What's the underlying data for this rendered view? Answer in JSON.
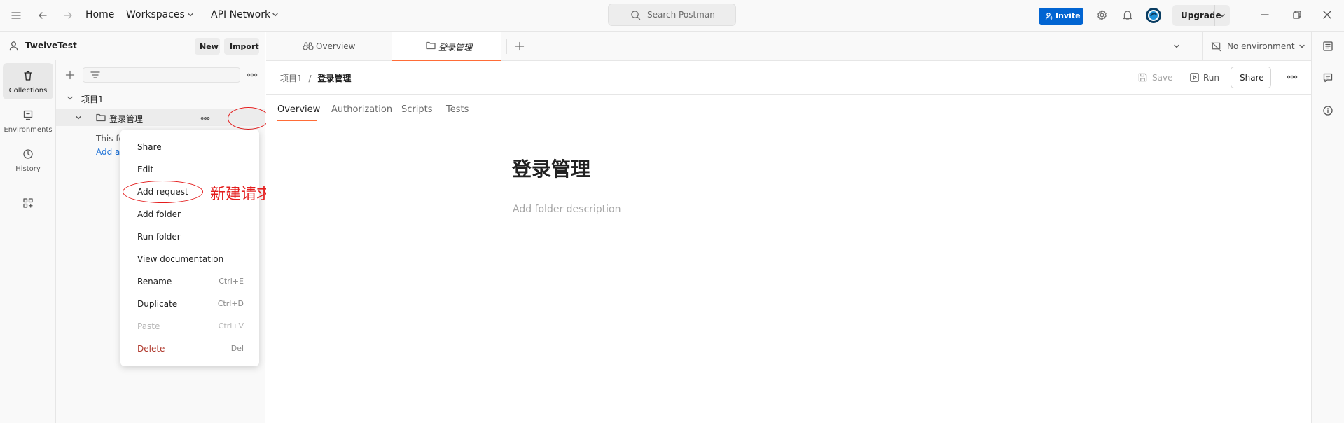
{
  "topbar": {
    "home": "Home",
    "workspaces": "Workspaces",
    "api_network": "API Network",
    "search_placeholder": "Search Postman",
    "invite": "Invite",
    "upgrade": "Upgrade"
  },
  "workspace": {
    "name": "TwelveTest",
    "new_label": "New",
    "import_label": "Import"
  },
  "rail": {
    "collections": "Collections",
    "environments": "Environments",
    "history": "History"
  },
  "tree": {
    "collection_name": "项目1",
    "folder_name": "登录管理",
    "hint_line1": "This fo",
    "hint_link": "Add a"
  },
  "context_menu": {
    "items": [
      {
        "label": "Share",
        "shortcut": ""
      },
      {
        "label": "Edit",
        "shortcut": ""
      },
      {
        "label": "Add request",
        "shortcut": ""
      },
      {
        "label": "Add folder",
        "shortcut": ""
      },
      {
        "label": "Run folder",
        "shortcut": ""
      },
      {
        "label": "View documentation",
        "shortcut": ""
      },
      {
        "label": "Rename",
        "shortcut": "Ctrl+E"
      },
      {
        "label": "Duplicate",
        "shortcut": "Ctrl+D"
      },
      {
        "label": "Paste",
        "shortcut": "Ctrl+V"
      },
      {
        "label": "Delete",
        "shortcut": "Del"
      }
    ]
  },
  "annotation": {
    "text": "新建请求",
    "color": "#e41c1c"
  },
  "tabs": {
    "overview": "Overview",
    "folder": "登录管理",
    "environment": "No environment"
  },
  "main": {
    "breadcrumb_parent": "项目1",
    "breadcrumb_sep": "/",
    "breadcrumb_current": "登录管理",
    "save": "Save",
    "run": "Run",
    "share": "Share",
    "tabs": [
      "Overview",
      "Authorization",
      "Scripts",
      "Tests"
    ],
    "title": "登录管理",
    "description_placeholder": "Add folder description"
  },
  "colors": {
    "accent": "#ff6c37",
    "invite_blue": "#0265d2",
    "danger": "#b03a2e"
  }
}
